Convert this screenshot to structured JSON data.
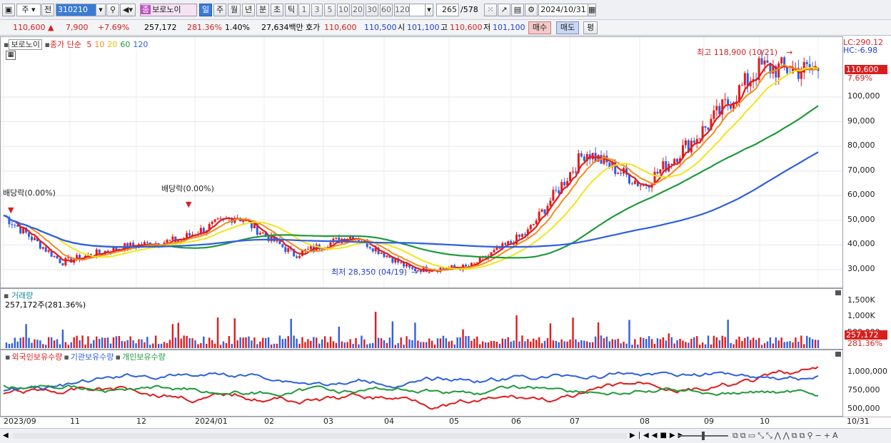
{
  "toolbar": {
    "period_sel": "주",
    "prev_label": "전",
    "stock_code": "310210",
    "stock_tag": "종",
    "stock_name": "보로노이",
    "tabs": [
      "일",
      "주",
      "월",
      "년",
      "분",
      "초",
      "틱"
    ],
    "num_buttons": [
      "1",
      "3",
      "5",
      "10",
      "20",
      "30",
      "60",
      "120"
    ],
    "count_value": "265",
    "count_total": "/578",
    "date_value": "2024/10/31"
  },
  "quote": {
    "price": "110,600",
    "change": "7,900",
    "change_pct": "+7.69%",
    "volume": "257,172",
    "volume_ratio": "281.36%",
    "turnover": "1.40%",
    "amount": "27,634백만",
    "hoga_label": "호가",
    "ask": "110,600",
    "bid": "110,500",
    "open_label": "시",
    "open": "101,100",
    "high_label": "고",
    "high": "110,600",
    "low_label": "저",
    "low": "101,100",
    "buy_label": "매수",
    "sell_label": "매도",
    "pyeong_label": "평"
  },
  "price_pane": {
    "stock_name": "보로노이",
    "legend_prefix": "종가 단순",
    "ma": [
      {
        "period": "5",
        "color": "#e31a1c"
      },
      {
        "period": "10",
        "color": "#f28c1a"
      },
      {
        "period": "20",
        "color": "#f2e51a"
      },
      {
        "period": "60",
        "color": "#1f9a3a"
      },
      {
        "period": "120",
        "color": "#2f5fe0"
      }
    ],
    "lc": "LC:290.12",
    "hc": "HC:-6.98",
    "current_price": "110,600",
    "current_pct": "7.69%",
    "high_annot": "최고 118,900 (10/21)",
    "low_annot": "최저 28,350 (04/19)",
    "div_annot": "배당락(0.00%)",
    "div_annot_left": "배당락(0.00%)",
    "y_ticks": [
      "100,000",
      "90,000",
      "80,000",
      "70,000",
      "60,000",
      "50,000",
      "40,000",
      "30,000"
    ]
  },
  "volume_pane": {
    "title": "거래량",
    "value": "257,172주(281.36%)",
    "y_ticks": [
      "1,500K",
      "1,000K",
      "500,000"
    ],
    "current": "257,172",
    "current_pct": "281.36%"
  },
  "holding_pane": {
    "legend": [
      {
        "label": "외국인보유수량",
        "color": "#e31a1c"
      },
      {
        "label": "기관보유수량",
        "color": "#2f5fe0"
      },
      {
        "label": "개인보유수량",
        "color": "#1f9a3a"
      }
    ],
    "y_ticks": [
      "1,000,000",
      "750,000",
      "500,000"
    ]
  },
  "x_axis": [
    "2023/09",
    "11",
    "12",
    "2024/01",
    "02",
    "03",
    "04",
    "05",
    "06",
    "07",
    "08",
    "09",
    "10",
    "10/31"
  ],
  "chart_data": {
    "type": "candlestick",
    "period": "daily",
    "x_range": [
      "2023/09",
      "2024/10/31"
    ],
    "ylim": [
      25000,
      125000
    ],
    "close_approx": {
      "x": [
        "2023/09",
        "2023/10",
        "2023/11",
        "2023/12",
        "2024/01",
        "2024/02",
        "2024/03",
        "2024/04",
        "2024/05",
        "2024/06",
        "2024/07",
        "2024/08",
        "2024/09",
        "2024/10",
        "2024/10/31"
      ],
      "y": [
        52000,
        33000,
        39000,
        42000,
        52000,
        36000,
        44000,
        30000,
        31000,
        45000,
        78000,
        64000,
        86000,
        112000,
        110600
      ]
    },
    "high": {
      "value": 118900,
      "date": "10/21"
    },
    "low": {
      "value": 28350,
      "date": "04/19"
    }
  }
}
